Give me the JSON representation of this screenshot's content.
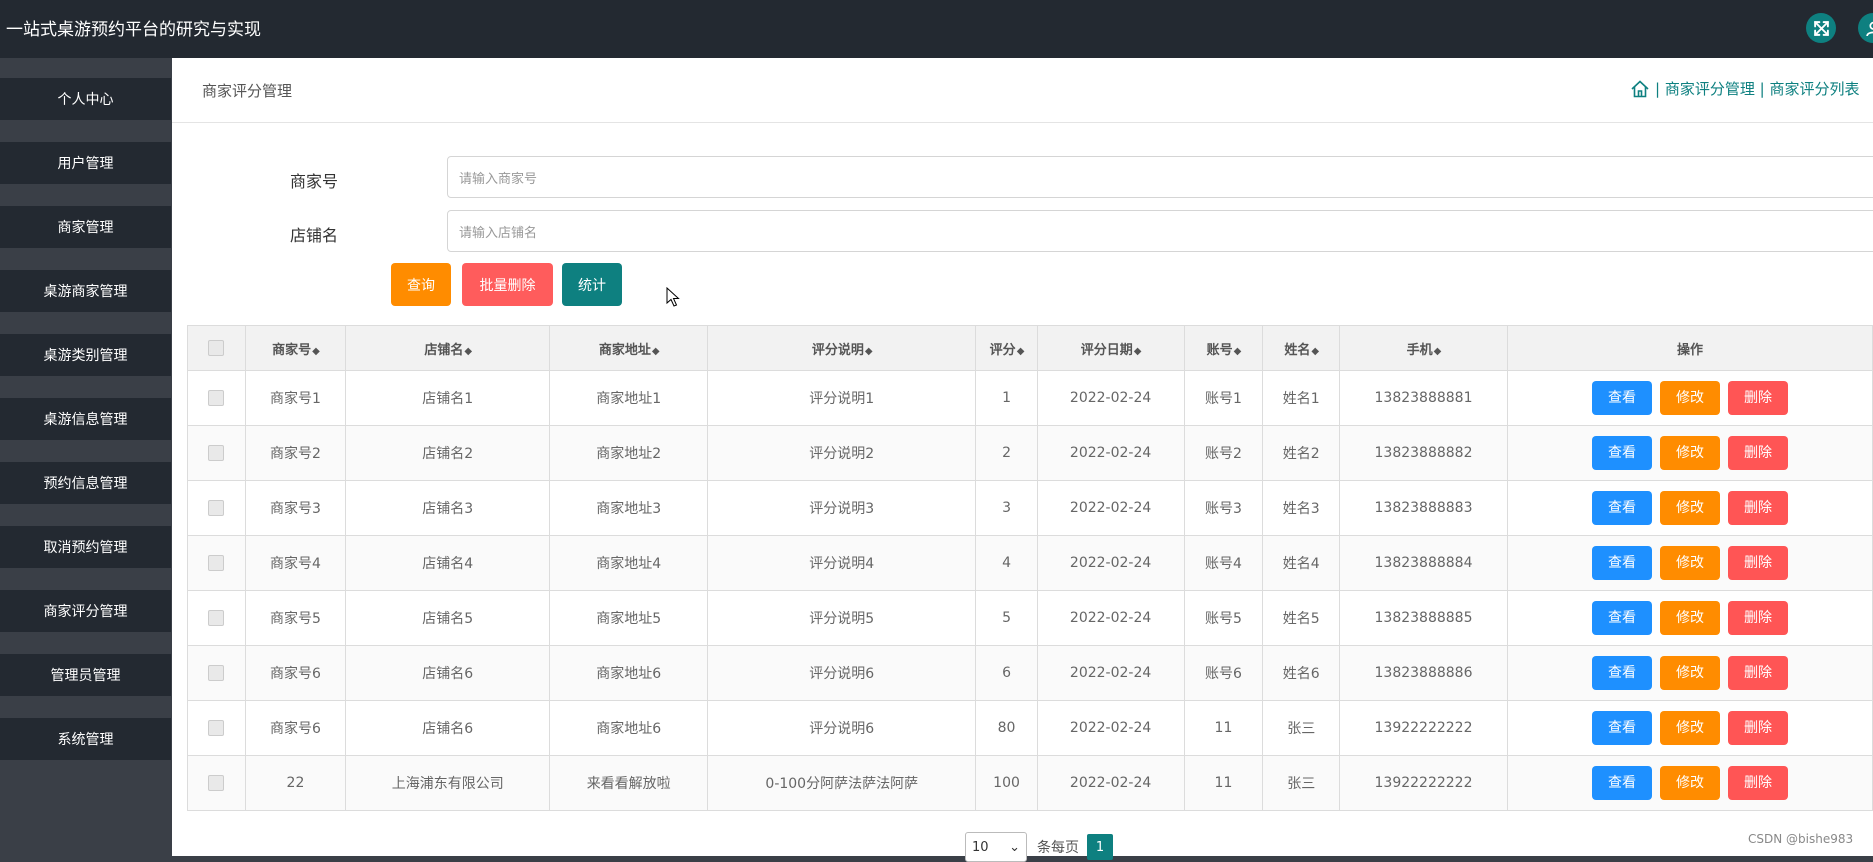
{
  "header": {
    "title": "一站式桌游预约平台的研究与实现"
  },
  "sidebar": {
    "items": [
      {
        "label": "个人中心"
      },
      {
        "label": "用户管理"
      },
      {
        "label": "商家管理"
      },
      {
        "label": "桌游商家管理"
      },
      {
        "label": "桌游类别管理"
      },
      {
        "label": "桌游信息管理"
      },
      {
        "label": "预约信息管理"
      },
      {
        "label": "取消预约管理"
      },
      {
        "label": "商家评分管理"
      },
      {
        "label": "管理员管理"
      },
      {
        "label": "系统管理"
      }
    ]
  },
  "breadcrumb": {
    "title": "商家评分管理",
    "sep1": "|",
    "path1": "商家评分管理",
    "sep2": "|",
    "path2": "商家评分列表"
  },
  "search": {
    "merchant_no_label": "商家号",
    "merchant_no_placeholder": "请输入商家号",
    "shop_name_label": "店铺名",
    "shop_name_placeholder": "请输入店铺名"
  },
  "buttons": {
    "query": "查询",
    "batch_delete": "批量删除",
    "stats": "统计"
  },
  "table": {
    "headers": [
      "商家号",
      "店铺名",
      "商家地址",
      "评分说明",
      "评分",
      "评分日期",
      "账号",
      "姓名",
      "手机",
      "操作"
    ],
    "sort_glyph": "◆",
    "actions": {
      "view": "查看",
      "edit": "修改",
      "delete": "删除"
    },
    "rows": [
      [
        "商家号1",
        "店铺名1",
        "商家地址1",
        "评分说明1",
        "1",
        "2022-02-24",
        "账号1",
        "姓名1",
        "13823888881"
      ],
      [
        "商家号2",
        "店铺名2",
        "商家地址2",
        "评分说明2",
        "2",
        "2022-02-24",
        "账号2",
        "姓名2",
        "13823888882"
      ],
      [
        "商家号3",
        "店铺名3",
        "商家地址3",
        "评分说明3",
        "3",
        "2022-02-24",
        "账号3",
        "姓名3",
        "13823888883"
      ],
      [
        "商家号4",
        "店铺名4",
        "商家地址4",
        "评分说明4",
        "4",
        "2022-02-24",
        "账号4",
        "姓名4",
        "13823888884"
      ],
      [
        "商家号5",
        "店铺名5",
        "商家地址5",
        "评分说明5",
        "5",
        "2022-02-24",
        "账号5",
        "姓名5",
        "13823888885"
      ],
      [
        "商家号6",
        "店铺名6",
        "商家地址6",
        "评分说明6",
        "6",
        "2022-02-24",
        "账号6",
        "姓名6",
        "13823888886"
      ],
      [
        "商家号6",
        "店铺名6",
        "商家地址6",
        "评分说明6",
        "80",
        "2022-02-24",
        "11",
        "张三",
        "13922222222"
      ],
      [
        "22",
        "上海浦东有限公司",
        "来看看解放啦",
        "0-100分阿萨法萨法阿萨",
        "100",
        "2022-02-24",
        "11",
        "张三",
        "13922222222"
      ]
    ]
  },
  "pagination": {
    "page_size": "10",
    "per_page_label": "条每页",
    "current_page": "1"
  },
  "watermark": "CSDN @bishe983",
  "colors": {
    "topbar": "#232931",
    "accent": "#0e8080",
    "query": "#ff8c00",
    "batch_delete": "#ff5c5c",
    "view": "#1e90ff",
    "edit": "#ff8c00",
    "delete": "#ff5555"
  }
}
